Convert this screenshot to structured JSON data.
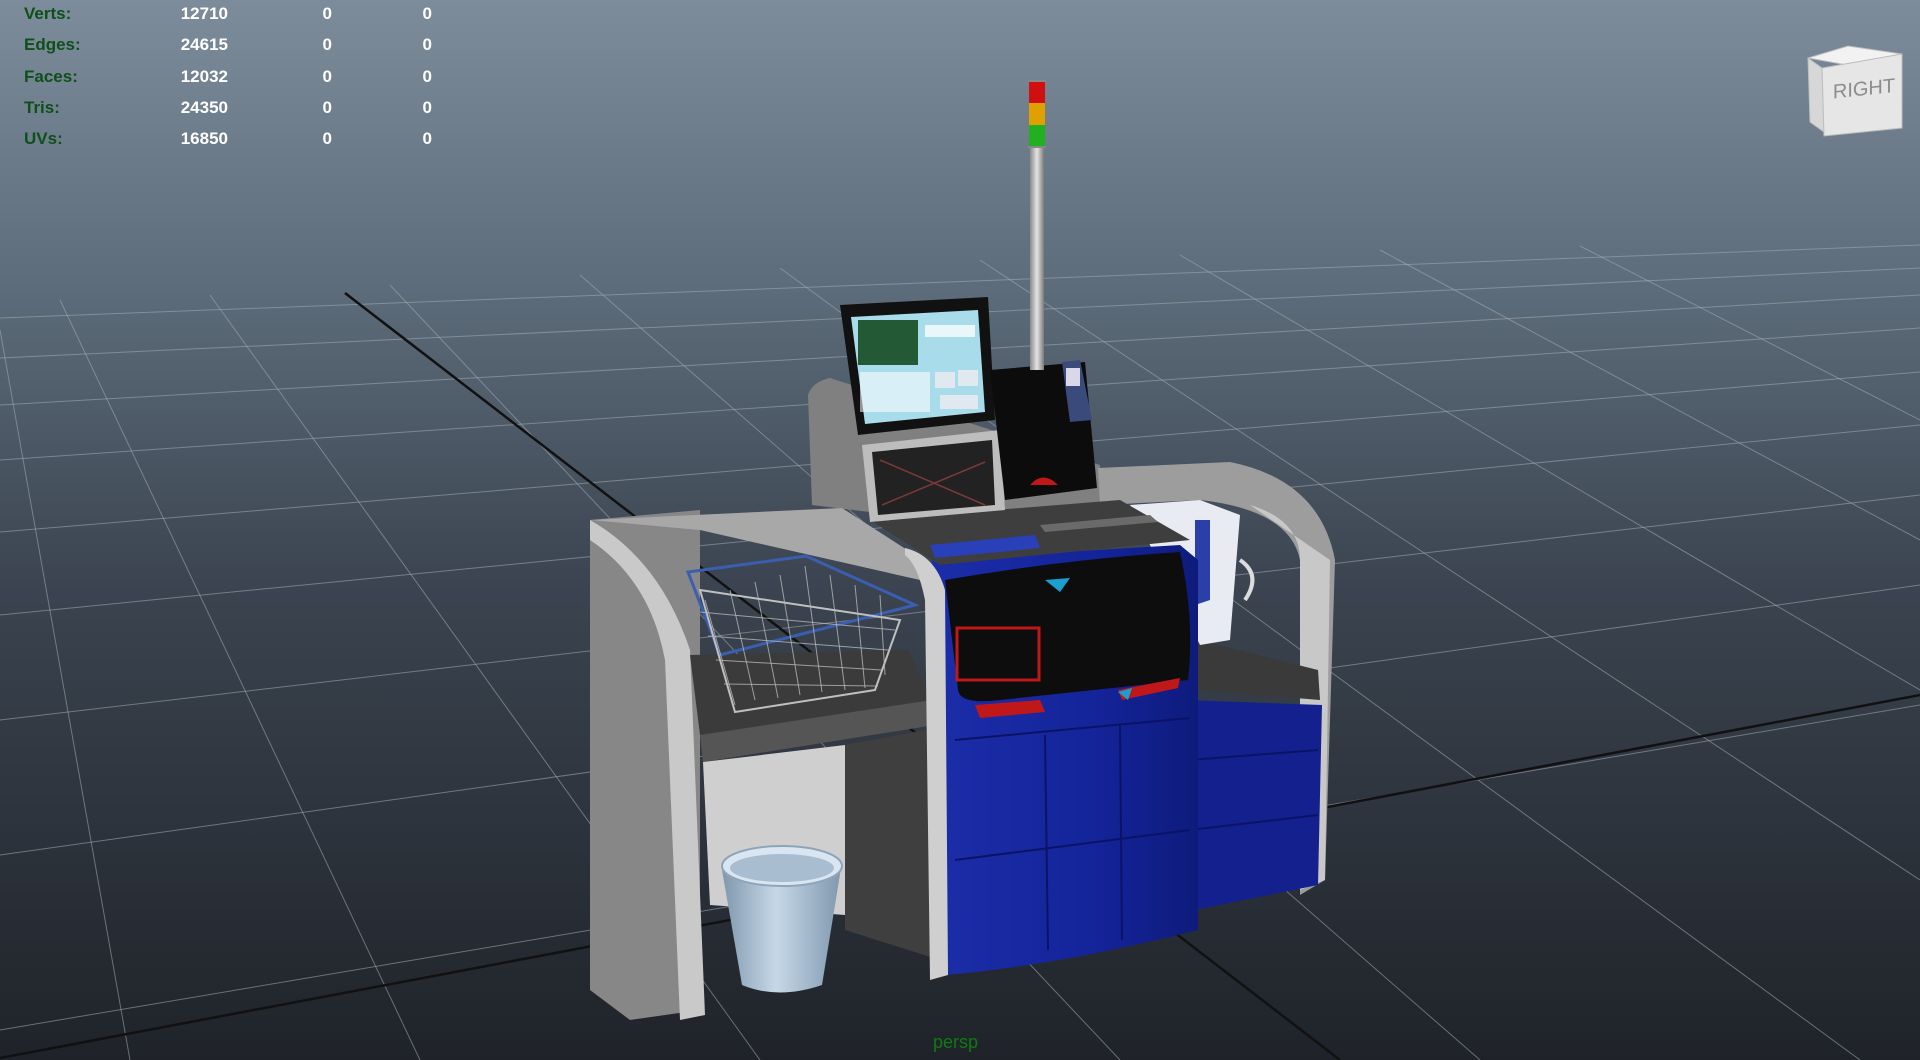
{
  "viewport": {
    "camera_name": "persp",
    "view_cube_face": "RIGHT"
  },
  "heads_up_display": {
    "rows": [
      {
        "label": "Verts:",
        "value": "12710",
        "selected": "0",
        "component": "0"
      },
      {
        "label": "Edges:",
        "value": "24615",
        "selected": "0",
        "component": "0"
      },
      {
        "label": "Faces:",
        "value": "12032",
        "selected": "0",
        "component": "0"
      },
      {
        "label": "Tris:",
        "value": "24350",
        "selected": "0",
        "component": "0"
      },
      {
        "label": "UVs:",
        "value": "16850",
        "selected": "0",
        "component": "0"
      }
    ]
  },
  "colors": {
    "hud_label": "#0e4f1a",
    "hud_value": "#ffffff",
    "camera_label": "#0f7a0f",
    "kiosk_blue": "#14249a",
    "kiosk_grey": "#9a9a9a",
    "status_light": [
      "#d01010",
      "#e0a000",
      "#20b020"
    ]
  }
}
